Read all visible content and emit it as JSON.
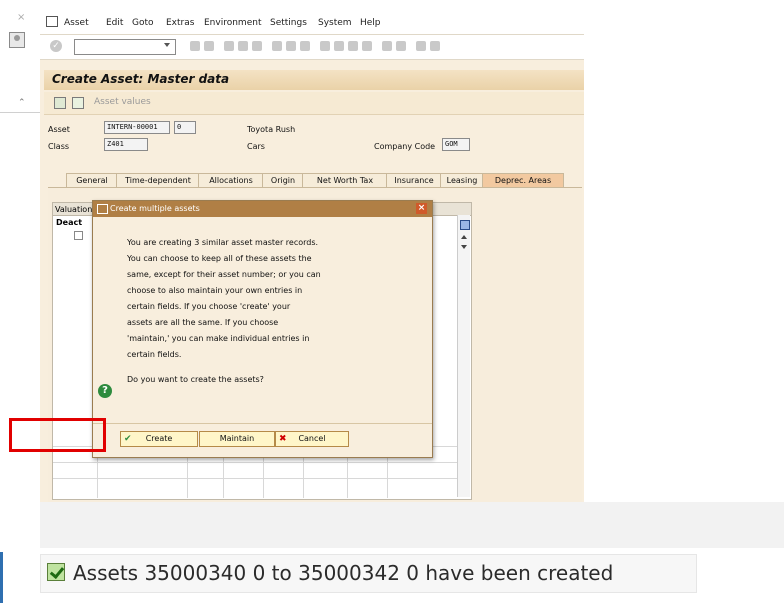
{
  "menu": {
    "items": [
      "Asset",
      "Edit",
      "Goto",
      "Extras",
      "Environment",
      "Settings",
      "System",
      "Help"
    ]
  },
  "page": {
    "title": "Create Asset:  Master data"
  },
  "appbar": {
    "asset_values": "Asset values"
  },
  "header": {
    "asset_label": "Asset",
    "asset_number": "INTERN-00001",
    "asset_sub": "0",
    "asset_description": "Toyota Rush",
    "class_label": "Class",
    "class_value": "Z401",
    "class_description": "Cars",
    "company_code_label": "Company Code",
    "company_code_value": "GOM"
  },
  "tabs": [
    "General",
    "Time-dependent",
    "Allocations",
    "Origin",
    "Net Worth Tax",
    "Insurance",
    "Leasing",
    "Deprec. Areas"
  ],
  "table": {
    "header": "Valuation",
    "col_deact": "Deact"
  },
  "dialog": {
    "title": "Create multiple assets",
    "lines": [
      "You are creating 3 similar asset master records.",
      "You can choose to keep all of these assets the",
      "same, except for their asset number; or you can",
      "choose to also maintain your own entries in",
      "certain fields. If you choose 'create' your",
      "assets are all the same. If you choose",
      "'maintain,' you can make individual entries in",
      "certain fields."
    ],
    "question": "Do you want to create the assets?",
    "create_label": "Create",
    "maintain_label": "Maintain",
    "cancel_label": "Cancel"
  },
  "status": {
    "message": "Assets 35000340 0 to 35000342 0 have been created"
  },
  "colors": {
    "sap_background": "#f8eedd",
    "dialog_titlebar": "#b07f45",
    "highlight": "#e10000",
    "success_green": "#2e8b3e"
  }
}
